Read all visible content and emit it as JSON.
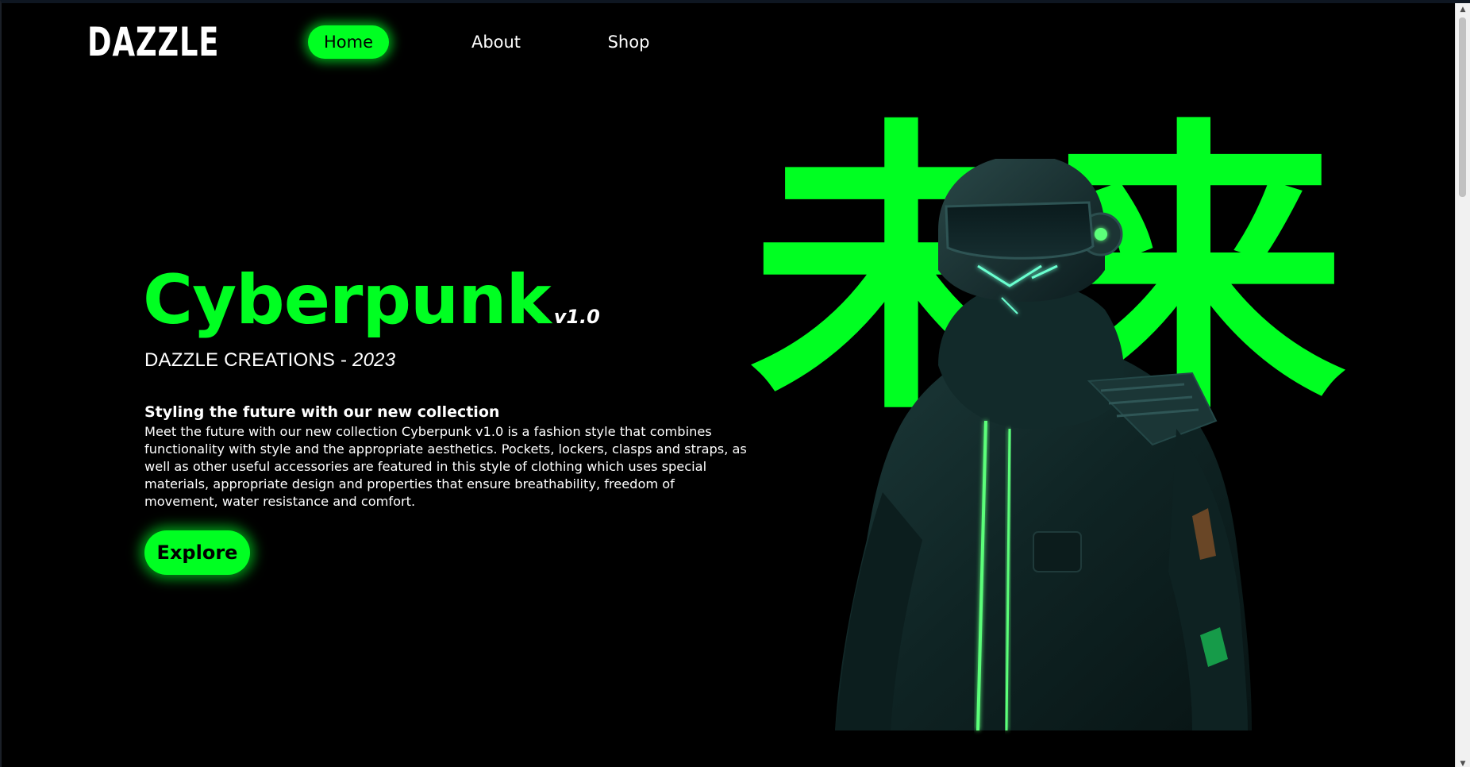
{
  "brand": {
    "logo": "DAZZLE",
    "accent": "#00ff22"
  },
  "nav": {
    "items": [
      {
        "label": "Home",
        "active": true
      },
      {
        "label": "About",
        "active": false
      },
      {
        "label": "Shop",
        "active": false
      }
    ]
  },
  "hero": {
    "title": "Cyberpunk",
    "version": "v1.0",
    "subtitle_prefix": "DAZZLE CREATIONS - ",
    "subtitle_year": "2023",
    "heading": "Styling the future with our new collection",
    "body": "Meet the future with our new collection Cyberpunk v1.0 is a fashion style that combines functionality with style and the appropriate aesthetics. Pockets, lockers, clasps and straps, as well as other useful accessories are featured in this style of clothing which uses special materials, appropriate design and properties that ensure breathability, freedom of movement, water resistance and comfort.",
    "cta_label": "Explore",
    "kanji": "未来"
  },
  "icons": {
    "scroll_up": "triangle-up-icon",
    "scroll_down": "triangle-down-icon"
  }
}
